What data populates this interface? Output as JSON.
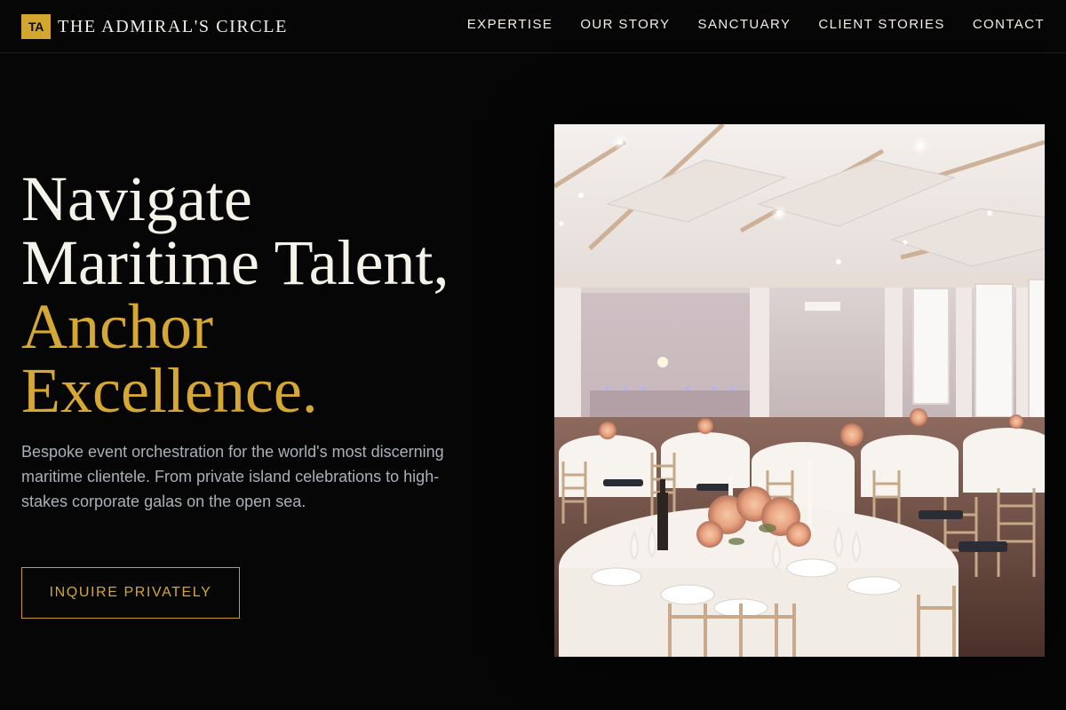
{
  "brand": {
    "mark": "TA",
    "name": "THE ADMIRAL'S CIRCLE"
  },
  "nav": {
    "items": [
      {
        "label": "EXPERTISE"
      },
      {
        "label": "OUR STORY"
      },
      {
        "label": "SANCTUARY"
      },
      {
        "label": "CLIENT STORIES"
      },
      {
        "label": "CONTACT"
      }
    ]
  },
  "hero": {
    "title_line_1": "Navigate",
    "title_line_2": "Maritime Talent,",
    "title_line_3": "Anchor",
    "title_line_4": "Excellence.",
    "description": "Bespoke event orchestration for the world's most discerning maritime clientele. From private island celebrations to high-stakes corporate galas on the open sea.",
    "cta_label": "INQUIRE PRIVATELY",
    "image_icon": "banquet-hall-photo"
  },
  "colors": {
    "background": "#060606",
    "accent": "#d5a733",
    "text": "#f5f2ea",
    "muted_text": "#aab0b9"
  }
}
